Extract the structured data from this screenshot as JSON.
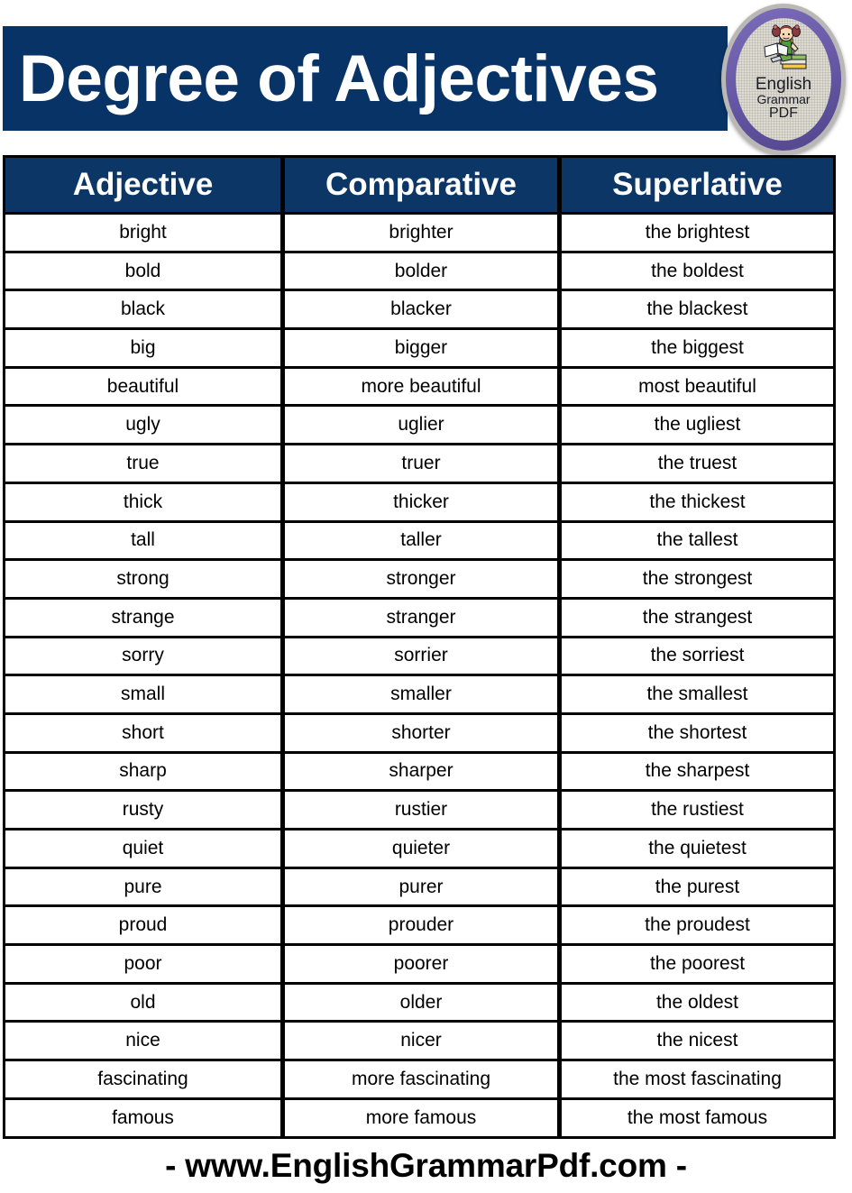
{
  "header": {
    "title": "Degree of Adjectives",
    "accent_color": "#073366"
  },
  "badge": {
    "icon_name": "english-grammar-pdf-logo",
    "line1": "English",
    "line2": "Grammar",
    "line3": "PDF",
    "ring_color": "#6f5fae",
    "face_color": "#dedcd2",
    "illustration": "girl-reading-book-on-stack-of-books"
  },
  "table": {
    "columns": [
      "Adjective",
      "Comparative",
      "Superlative"
    ],
    "rows": [
      [
        "bright",
        "brighter",
        "the brightest"
      ],
      [
        "bold",
        "bolder",
        "the boldest"
      ],
      [
        "black",
        "blacker",
        "the blackest"
      ],
      [
        "big",
        "bigger",
        "the biggest"
      ],
      [
        "beautiful",
        "more beautiful",
        "most beautiful"
      ],
      [
        "ugly",
        "uglier",
        "the ugliest"
      ],
      [
        "true",
        "truer",
        "the truest"
      ],
      [
        "thick",
        "thicker",
        "the thickest"
      ],
      [
        "tall",
        "taller",
        "the tallest"
      ],
      [
        "strong",
        "stronger",
        "the strongest"
      ],
      [
        "strange",
        "stranger",
        "the strangest"
      ],
      [
        "sorry",
        "sorrier",
        "the sorriest"
      ],
      [
        "small",
        "smaller",
        "the smallest"
      ],
      [
        "short",
        "shorter",
        "the shortest"
      ],
      [
        "sharp",
        "sharper",
        "the sharpest"
      ],
      [
        "rusty",
        "rustier",
        "the rustiest"
      ],
      [
        "quiet",
        "quieter",
        "the quietest"
      ],
      [
        "pure",
        "purer",
        "the purest"
      ],
      [
        "proud",
        "prouder",
        "the proudest"
      ],
      [
        "poor",
        "poorer",
        "the poorest"
      ],
      [
        "old",
        "older",
        "the oldest"
      ],
      [
        "nice",
        "nicer",
        "the nicest"
      ],
      [
        "fascinating",
        "more fascinating",
        "the most fascinating"
      ],
      [
        "famous",
        "more famous",
        "the most famous"
      ]
    ]
  },
  "footer": {
    "text": "-  www.EnglishGrammarPdf.com  -"
  }
}
